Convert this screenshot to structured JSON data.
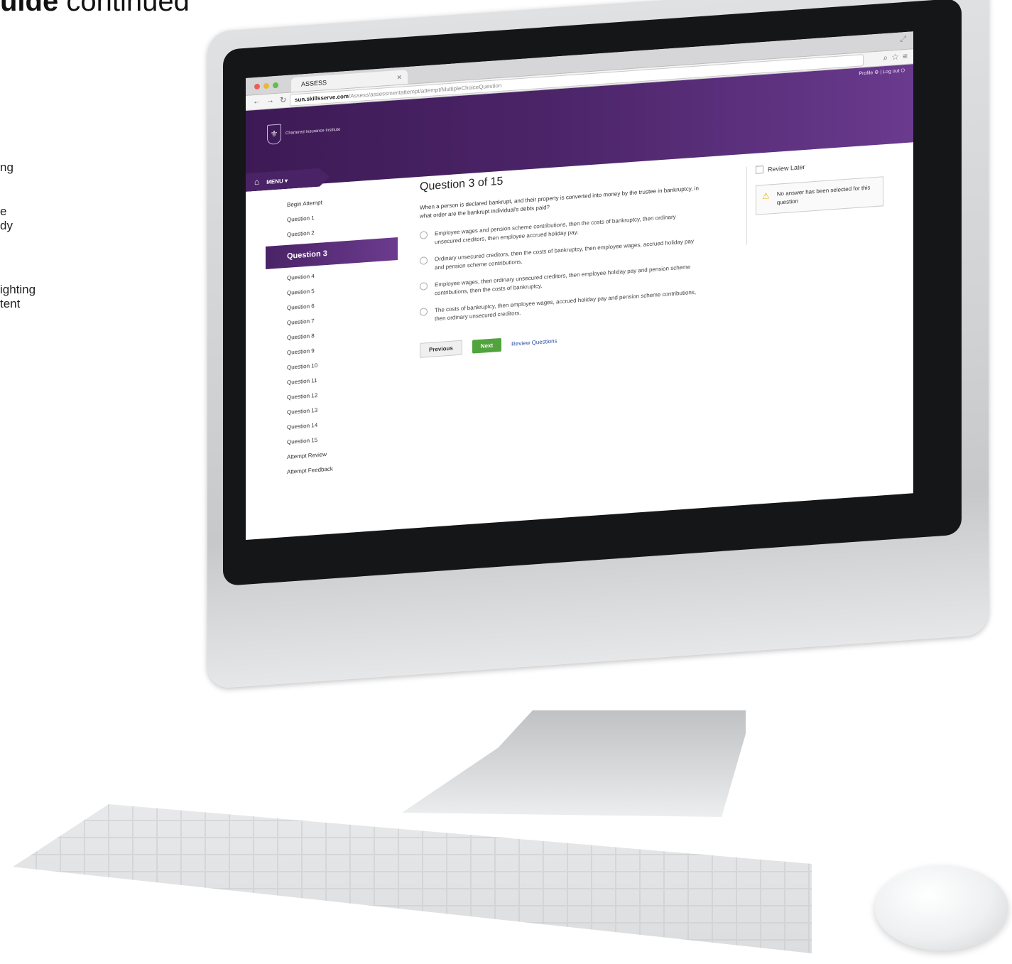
{
  "page": {
    "heading_bold": "uide",
    "heading_rest": " continued",
    "notes": [
      "ng",
      "e\ndy",
      "ighting\ntent"
    ]
  },
  "browser": {
    "tab_title": "ASSESS",
    "url_host": "sun.skillsserve.com",
    "url_path": "/Assess/assessmentattempt/attempt/MultipleChoiceQuestion"
  },
  "header": {
    "logo_text": "Chartered Insurance Institute",
    "top_right": "Profile  ⚙  |  Log out  ⏻",
    "menu_label": "MENU  ▾"
  },
  "sidebar": {
    "items": [
      {
        "label": "Begin Attempt"
      },
      {
        "label": "Question 1"
      },
      {
        "label": "Question 2"
      },
      {
        "label": "Question 3"
      },
      {
        "label": "Question 4"
      },
      {
        "label": "Question 5"
      },
      {
        "label": "Question 6"
      },
      {
        "label": "Question 7"
      },
      {
        "label": "Question 8"
      },
      {
        "label": "Question 9"
      },
      {
        "label": "Question 10"
      },
      {
        "label": "Question 11"
      },
      {
        "label": "Question 12"
      },
      {
        "label": "Question 13"
      },
      {
        "label": "Question 14"
      },
      {
        "label": "Question 15"
      },
      {
        "label": "Attempt Review"
      },
      {
        "label": "Attempt Feedback"
      }
    ],
    "active_index": 3
  },
  "question": {
    "heading": "Question 3 of 15",
    "text": "When a person is declared bankrupt, and their property is converted into money by the trustee in bankruptcy, in what order are the bankrupt individual's debts paid?",
    "options": [
      "Employee wages and pension scheme contributions, then the costs of bankruptcy, then ordinary unsecured creditors, then employee accrued holiday pay.",
      "Ordinary unsecured creditors, then the costs of bankruptcy, then employee wages, accrued holiday pay and pension scheme contributions.",
      "Employee wages, then ordinary unsecured creditors, then employee holiday pay and pension scheme contributions, then the costs of bankruptcy.",
      "The costs of bankruptcy, then employee wages, accrued holiday pay and pension scheme contributions, then ordinary unsecured creditors."
    ]
  },
  "buttons": {
    "previous": "Previous",
    "next": "Next",
    "review": "Review Questions"
  },
  "panel": {
    "review_later": "Review Later",
    "alert": "No answer has been selected for this question"
  }
}
